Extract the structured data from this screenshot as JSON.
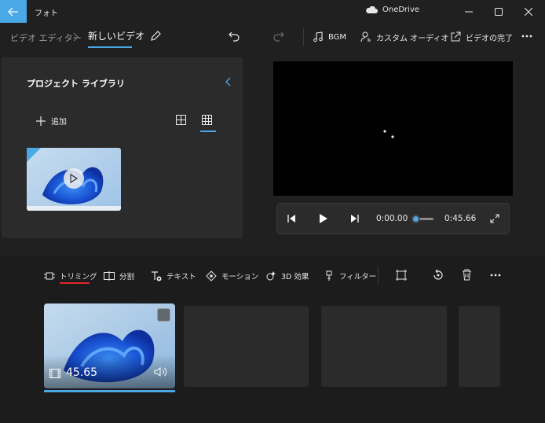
{
  "window": {
    "title": "フォト",
    "cloud_label": "OneDrive"
  },
  "toolbar": {
    "breadcrumb_root": "ビデオ エディター",
    "breadcrumb_current": "新しいビデオ",
    "bgm_label": "BGM",
    "custom_audio_label": "カスタム オーディオ",
    "finish_label": "ビデオの完了"
  },
  "library": {
    "title": "プロジェクト ライブラリ",
    "add_label": "追加"
  },
  "player": {
    "current_time": "0:00.00",
    "total_time": "0:45.66",
    "progress": 0.0
  },
  "storyboard": {
    "tools": {
      "trim": "トリミング",
      "split": "分割",
      "text": "テキスト",
      "motion": "モーション",
      "effects_3d": "3D 効果",
      "filters": "フィルター"
    },
    "clips": [
      {
        "duration": "45.65"
      }
    ]
  },
  "colors": {
    "accent": "#4aa8e6",
    "trim_underline": "#e0262a",
    "background": "#202020",
    "panel": "#2b2b2b"
  }
}
